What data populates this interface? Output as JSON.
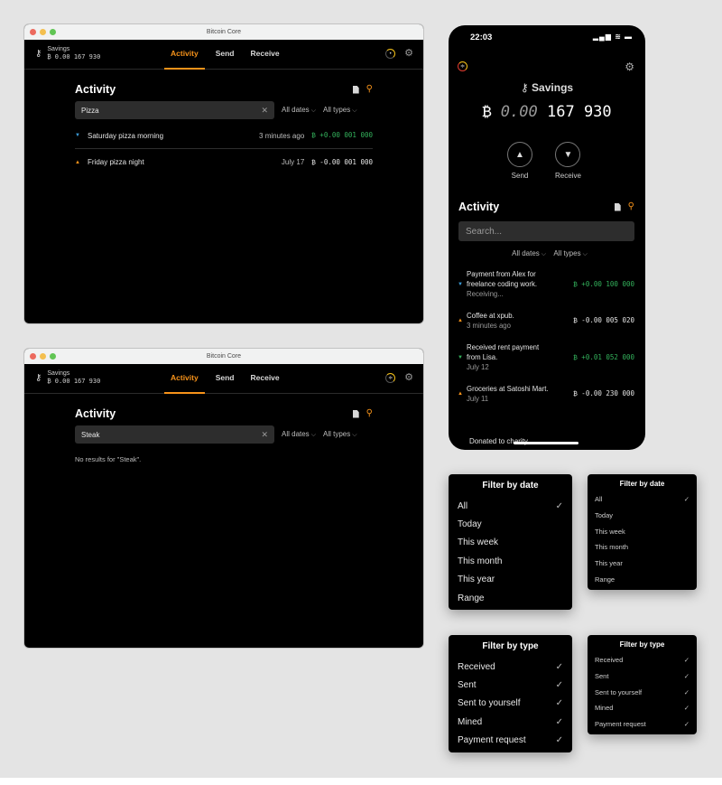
{
  "desktop": {
    "window_title": "Bitcoin Core",
    "wallet": {
      "name": "Savings",
      "balance": "₿ 0.00 167 930"
    },
    "nav": [
      "Activity",
      "Send",
      "Receive"
    ],
    "active_nav": "Activity",
    "filters": {
      "dates": "All dates",
      "types": "All types"
    },
    "activity_title": "Activity",
    "screen1": {
      "search_value": "Pizza",
      "transactions": [
        {
          "direction": "in",
          "label": "Saturday pizza morning",
          "when": "3 minutes ago",
          "amount": "₿ +0.00 001 000"
        },
        {
          "direction": "out",
          "label": "Friday pizza night",
          "when": "July 17",
          "amount": "₿ -0.00 001 000"
        }
      ]
    },
    "screen2": {
      "search_value": "Steak",
      "no_results": "No results for \"Steak\"."
    }
  },
  "phone": {
    "time": "22:03",
    "signal": "▂▄▆ ≋ ▬",
    "wallet_name": "Savings",
    "balance_symbol": "₿",
    "balance_dim": "0.00",
    "balance_main": "167 930",
    "send_label": "Send",
    "receive_label": "Receive",
    "activity_title": "Activity",
    "search_placeholder": "Search...",
    "filters": {
      "dates": "All dates",
      "types": "All types"
    },
    "transactions": [
      {
        "direction": "in-pending",
        "lines": [
          "Payment from Alex for",
          "freelance coding work."
        ],
        "sub": "Receiving...",
        "amount": "₿ +0.00 100 000"
      },
      {
        "direction": "out",
        "lines": [
          "Coffee at xpub."
        ],
        "sub": "3 minutes ago",
        "amount": "₿ -0.00 005 020"
      },
      {
        "direction": "in",
        "lines": [
          "Received rent payment",
          "from Lisa."
        ],
        "sub": "July 12",
        "amount": "₿ +0.01 052 000"
      },
      {
        "direction": "out",
        "lines": [
          "Groceries at Satoshi Mart."
        ],
        "sub": "July 11",
        "amount": "₿ -0.00 230 000"
      }
    ],
    "last_item_partial": "Donated to charity"
  },
  "date_menu": {
    "title": "Filter by date",
    "items": [
      "All",
      "Today",
      "This week",
      "This month",
      "This year",
      "Range"
    ],
    "selected": "All"
  },
  "type_menu": {
    "title": "Filter by type",
    "items": [
      "Received",
      "Sent",
      "Sent to yourself",
      "Mined",
      "Payment request"
    ],
    "all_checked": true
  },
  "icons": {
    "check": "✓",
    "chevron": "⌵",
    "clear": "✕",
    "search": "⚲",
    "gear": "⚙",
    "key": "🔑"
  }
}
